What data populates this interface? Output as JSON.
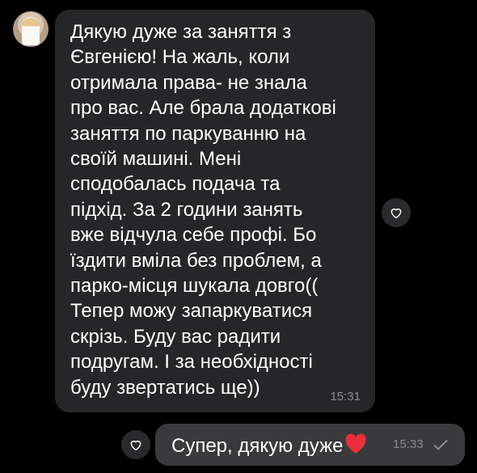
{
  "chat": {
    "incoming": {
      "text": "Дякую дуже за заняття з\nЄвгенією! На жаль, коли\nотримала права- не знала\nпро вас. Але брала додаткові\nзаняття по паркуванню на\nсвоїй машині. Мені\nсподобалась подача та\nпідхід. За 2 години занять\nвже відчула себе профі. Бо\nїздити вміла без проблем, а\nпарко-місця шукала довго((\nТепер можу запаркуватися\nскрізь. Буду вас радити\nподругам. І за необхідності\nбуду звертатись ще))",
      "time": "15:31"
    },
    "outgoing": {
      "text": "Супер, дякую дуже",
      "emoji_icon": "red-heart-icon",
      "time": "15:33",
      "status_icon": "checkmark-icon"
    }
  },
  "colors": {
    "background": "#000000",
    "incoming_bubble": "#262628",
    "outgoing_bubble": "#3a3a3c",
    "heart": "#e8303a",
    "timestamp": "#8c8c90"
  }
}
